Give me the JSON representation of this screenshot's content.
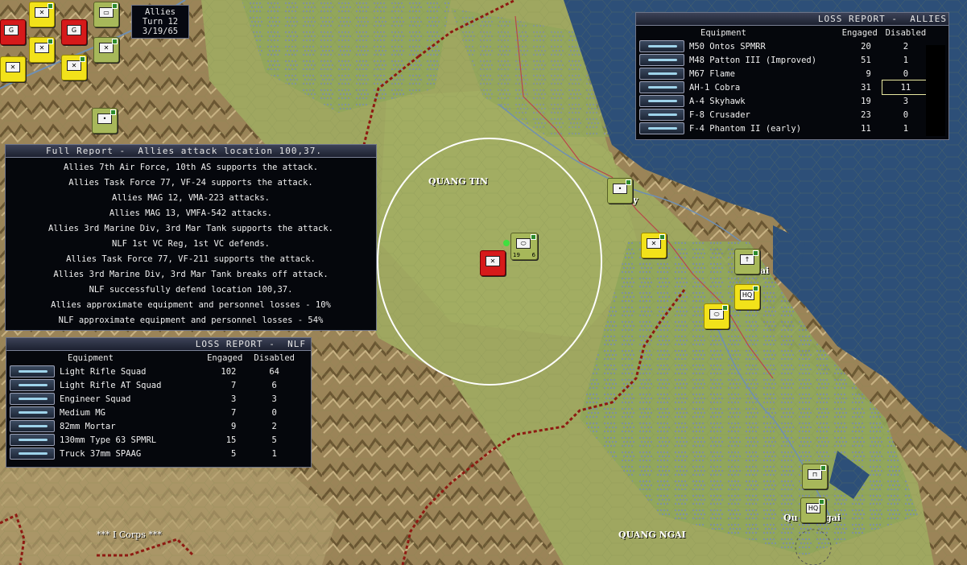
{
  "turn_info": {
    "side": "Allies",
    "turn": "Turn 12",
    "date": "3/19/65"
  },
  "map_labels": {
    "province_quang_tin": "QUANG TIN",
    "province_quang_ngai": "QUANG NGAI",
    "corps": "*** I Corps ***",
    "city_tam_ky_fragment": "y",
    "city_chu_lai_fragment": "ai",
    "city_quang_ngai_fragment": "Qu",
    "city_quang_ngai_fragment2": "gai"
  },
  "full_report": {
    "title": "Full Report -  Allies attack location 100,37.",
    "lines": [
      "Allies 7th Air Force, 10th AS supports the attack.",
      "Allies Task Force 77, VF-24 supports the attack.",
      "Allies MAG 12, VMA-223 attacks.",
      "Allies MAG 13, VMFA-542 attacks.",
      "Allies 3rd Marine Div, 3rd Mar Tank supports the attack.",
      "NLF 1st VC Reg, 1st VC defends.",
      "Allies Task Force 77, VF-211 supports the attack.",
      "Allies 3rd Marine Div, 3rd Mar Tank breaks off attack.",
      "NLF successfully defend location 100,37.",
      "Allies approximate equipment and personnel losses - 10%",
      "NLF approximate equipment and personnel losses - 54%"
    ]
  },
  "loss_allies": {
    "title": "LOSS REPORT -  ALLIES",
    "col_equipment": "Equipment",
    "col_engaged": "Engaged",
    "col_disabled": "Disabled",
    "rows": [
      {
        "name": "M50 Ontos SPMRR",
        "engaged": "20",
        "disabled": "2"
      },
      {
        "name": "M48 Patton III (Improved)",
        "engaged": "51",
        "disabled": "1"
      },
      {
        "name": "M67 Flame",
        "engaged": "9",
        "disabled": "0"
      },
      {
        "name": "AH-1 Cobra",
        "engaged": "31",
        "disabled": "11"
      },
      {
        "name": "A-4 Skyhawk",
        "engaged": "19",
        "disabled": "3"
      },
      {
        "name": "F-8 Crusader",
        "engaged": "23",
        "disabled": "0"
      },
      {
        "name": "F-4 Phantom II (early)",
        "engaged": "11",
        "disabled": "1"
      }
    ]
  },
  "loss_nlf": {
    "title": "LOSS REPORT -  NLF",
    "col_equipment": "Equipment",
    "col_engaged": "Engaged",
    "col_disabled": "Disabled",
    "rows": [
      {
        "name": "Light Rifle Squad",
        "engaged": "102",
        "disabled": "64"
      },
      {
        "name": "Light Rifle AT Squad",
        "engaged": "7",
        "disabled": "6"
      },
      {
        "name": "Engineer Squad",
        "engaged": "3",
        "disabled": "3"
      },
      {
        "name": "Medium MG",
        "engaged": "7",
        "disabled": "0"
      },
      {
        "name": "82mm Mortar",
        "engaged": "9",
        "disabled": "2"
      },
      {
        "name": "130mm Type 63 SPMRL",
        "engaged": "15",
        "disabled": "5"
      },
      {
        "name": "Truck 37mm SPAAG",
        "engaged": "5",
        "disabled": "1"
      }
    ]
  },
  "units": {
    "selected_stats_a": "19",
    "selected_stats_b": "6",
    "hq_label": "HQ",
    "red_unit_label": "G",
    "hq2_label": "HQ"
  },
  "colors": {
    "land": "#9aa35a",
    "sea": "#2d4f78",
    "border": "#8e1a12",
    "panel": "#05070c"
  }
}
